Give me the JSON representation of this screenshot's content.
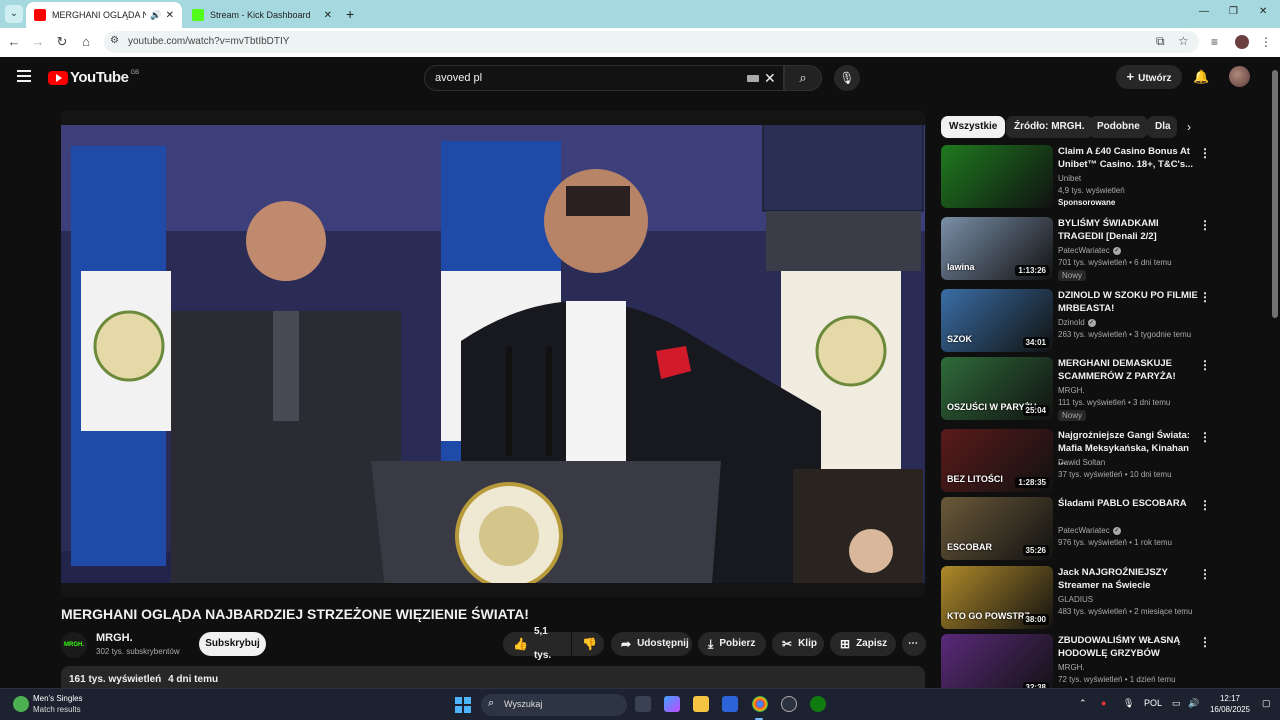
{
  "browser": {
    "tabs": [
      {
        "title": "MERGHANI OGLĄDA NAJBARDZIEJ STRZEŻONE WIĘZIENIE ŚWIATA!",
        "active": true,
        "favicon_color": "#ff0000"
      },
      {
        "title": "Stream - Kick Dashboard",
        "active": false,
        "favicon_color": "#53fc18"
      }
    ],
    "new_tab": "+",
    "url": "youtube.com/watch?v=mvTbtIbDTIY"
  },
  "yt": {
    "logo_word": "YouTube",
    "country_code": "GB",
    "search_value": "avoved pl",
    "create_label": "Utwórz"
  },
  "video": {
    "title": "MERGHANI OGLĄDA NAJBARDZIEJ STRZEŻONE WIĘZIENIE ŚWIATA!",
    "channel": "MRGH.",
    "channel_logo_text": "MRGH.",
    "subscribers": "302 tys. subskrybentów",
    "subscribe_label": "Subskrybuj",
    "likes": "5,1 tys.",
    "share_label": "Udostępnij",
    "download_label": "Pobierz",
    "clip_label": "Klip",
    "save_label": "Zapisz",
    "views": "161 tys. wyświetleń",
    "age": "4 dni temu"
  },
  "chips": [
    "Wszystkie",
    "Źródło: MRGH.",
    "Podobne",
    "Dla"
  ],
  "recommendations": [
    {
      "title": "Claim A £40 Casino Bonus At Unibet™ Casino. 18+, T&C's...",
      "channel": "Unibet",
      "meta": "4,9 tys. wyświetleń",
      "extra": "Sponsorowane",
      "duration": "",
      "verified": false,
      "thumb": "#1f7a1f"
    },
    {
      "title": "BYLIŚMY ŚWIADKAMI TRAGEDII [Denali 2/2]",
      "channel": "PatecWariatec",
      "meta": "701 tys. wyświetleń • 6 dni temu",
      "extra": "Nowy",
      "duration": "1:13:26",
      "verified": true,
      "thumb": "#7a8fa8",
      "thumb_text": "lawina"
    },
    {
      "title": "DZINOLD W SZOKU PO FILMIE MRBEASTA!",
      "channel": "Dzinold",
      "meta": "263 tys. wyświetleń • 3 tygodnie temu",
      "extra": "",
      "duration": "34:01",
      "verified": true,
      "thumb": "#3a6ea5",
      "thumb_text": "SZOK"
    },
    {
      "title": "MERGHANI DEMASKUJE SCAMMERÓW Z PARYŻA!",
      "channel": "MRGH.",
      "meta": "111 tys. wyświetleń • 3 dni temu",
      "extra": "Nowy",
      "duration": "25:04",
      "verified": false,
      "thumb": "#2f6b3a",
      "thumb_text": "OSZUŚCI W PARYŻU"
    },
    {
      "title": "Najgroźniejsze Gangi Świata: Mafia Meksykańska, Kinahan ...",
      "channel": "Dawid Soltan",
      "meta": "37 tys. wyświetleń • 10 dni temu",
      "extra": "",
      "duration": "1:28:35",
      "verified": false,
      "thumb": "#5a1a1a",
      "thumb_text": "BEZ LITOŚCI"
    },
    {
      "title": "Śladami PABLO ESCOBARA",
      "channel": "PatecWariatec",
      "meta": "976 tys. wyświetleń • 1 rok temu",
      "extra": "",
      "duration": "35:26",
      "verified": true,
      "thumb": "#6b5a3a",
      "thumb_text": "ESCOBAR"
    },
    {
      "title": "Jack NAJGROŹNIEJSZY Streamer na Świecie",
      "channel": "GLADIUS",
      "meta": "483 tys. wyświetleń • 2 miesiące temu",
      "extra": "",
      "duration": "38:00",
      "verified": false,
      "thumb": "#b08a2a",
      "thumb_text": "KTO GO POWSTRZ"
    },
    {
      "title": "ZBUDOWALIŚMY WŁASNĄ HODOWLĘ GRZYBÓW",
      "channel": "MRGH.",
      "meta": "72 tys. wyświetleń • 1 dzień temu",
      "extra": "",
      "duration": "32:38",
      "verified": false,
      "thumb": "#5a2a7a"
    }
  ],
  "taskbar": {
    "widget_title": "Men's Singles",
    "widget_sub": "Match results",
    "search_label": "Wyszukaj",
    "lang": "POL",
    "time": "12:17",
    "date": "16/08/2025"
  }
}
